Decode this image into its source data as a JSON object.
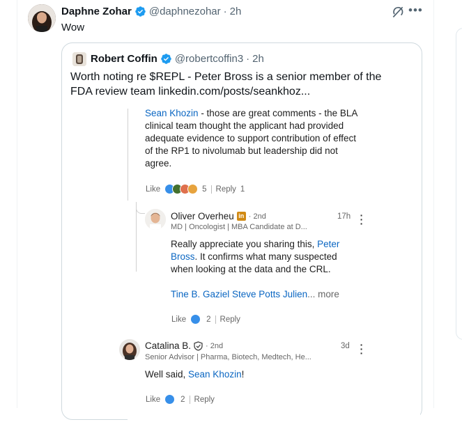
{
  "tweet": {
    "author_name": "Daphne Zohar",
    "handle": "@daphnezohar",
    "dot": "·",
    "time": "2h",
    "text": "Wow"
  },
  "quote": {
    "author_name": "Robert Coffin",
    "handle": "@robertcoffin3",
    "dot": "·",
    "time": "2h",
    "text": "Worth noting re $REPL - Peter Bross is a senior member of the FDA review team linkedin.com/posts/seankhoz..."
  },
  "linkedin": {
    "post": {
      "mention": "Sean Khozin",
      "text": " - those are great comments - the BLA clinical team thought the applicant had provided adequate evidence to support contribution of effect of the RP1 to nivolumab but leadership did not agree.",
      "like": "Like",
      "reactions": "5",
      "reply": "Reply",
      "reply_count": "1"
    },
    "comment1": {
      "name": "Oliver Overheu",
      "degree": "· 2nd",
      "subtitle": "MD | Oncologist | MBA Candidate at D...",
      "time": "17h",
      "text_a": "Really appreciate you sharing this, ",
      "mention": "Peter Bross",
      "text_b": ". It confirms what many suspected when looking at the data and the CRL.",
      "tags": "Tine B. Gaziel Steve Potts Julien",
      "more": "... more",
      "like": "Like",
      "reactions": "2",
      "reply": "Reply"
    },
    "comment2": {
      "name": "Catalina B.",
      "degree": "· 2nd",
      "subtitle": "Senior Advisor | Pharma, Biotech, Medtech, He...",
      "time": "3d",
      "text_a": "Well said, ",
      "mention": "Sean Khozin",
      "text_b": "!",
      "like": "Like",
      "reactions": "2",
      "reply": "Reply"
    }
  },
  "colors": {
    "verified": "#1d9bf0",
    "link": "#0a66c2",
    "muted": "#536471"
  }
}
